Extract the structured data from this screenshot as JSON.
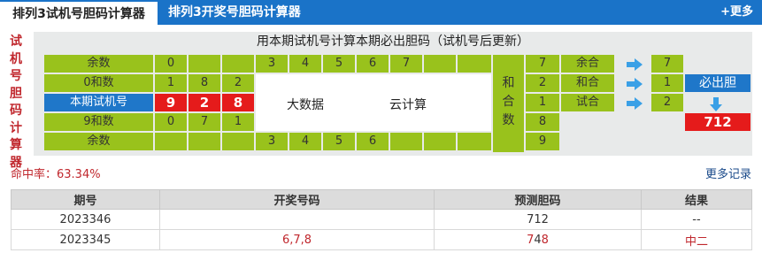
{
  "tabs": [
    {
      "label": "排列3试机号胆码计算器"
    },
    {
      "label": "排列3开奖号胆码计算器"
    }
  ],
  "more_link": "+更多",
  "vertical_title": [
    "试",
    "机",
    "号",
    "胆",
    "码",
    "计",
    "算",
    "器"
  ],
  "grid": {
    "caption": "用本期试机号计算本期必出胆码（试机号后更新）",
    "rows": [
      {
        "label": "余数",
        "cols": [
          "0",
          "",
          ""
        ],
        "extra": [
          "3",
          "4",
          "5",
          "6",
          "7"
        ]
      },
      {
        "label": "0和数",
        "cols": [
          "1",
          "8",
          "2"
        ],
        "extra": []
      },
      {
        "label": "本期试机号",
        "cols": [
          "9",
          "2",
          "8"
        ],
        "extra": []
      },
      {
        "label": "9和数",
        "cols": [
          "0",
          "7",
          "1"
        ],
        "extra": []
      },
      {
        "label": "余数",
        "cols": [
          "",
          "",
          ""
        ],
        "extra": [
          "3",
          "4",
          "5",
          "6"
        ]
      }
    ],
    "middle_texts": [
      "大数据",
      "云计算"
    ],
    "he_label": [
      "和",
      "合",
      "数"
    ],
    "he_values": [
      "7",
      "2",
      "1",
      "8",
      "9"
    ],
    "he_names": [
      "余合",
      "和合",
      "试合"
    ],
    "result_values": [
      "7",
      "1",
      "2"
    ],
    "bidan_label": "必出胆",
    "bidan_value": "712"
  },
  "hit_rate": "命中率：63.34%",
  "more_records": "更多记录",
  "history": {
    "headers": [
      "期号",
      "开奖号码",
      "预测胆码",
      "结果"
    ],
    "rows": [
      {
        "period": "2023346",
        "draw": "",
        "predict": "712",
        "result": "--"
      },
      {
        "period": "2023345",
        "draw": "6,7,8",
        "predict": "748",
        "result": "中二"
      }
    ]
  },
  "colors": {
    "accent": "#1a73c8",
    "green": "#99c21c",
    "red": "#e51b1b"
  }
}
